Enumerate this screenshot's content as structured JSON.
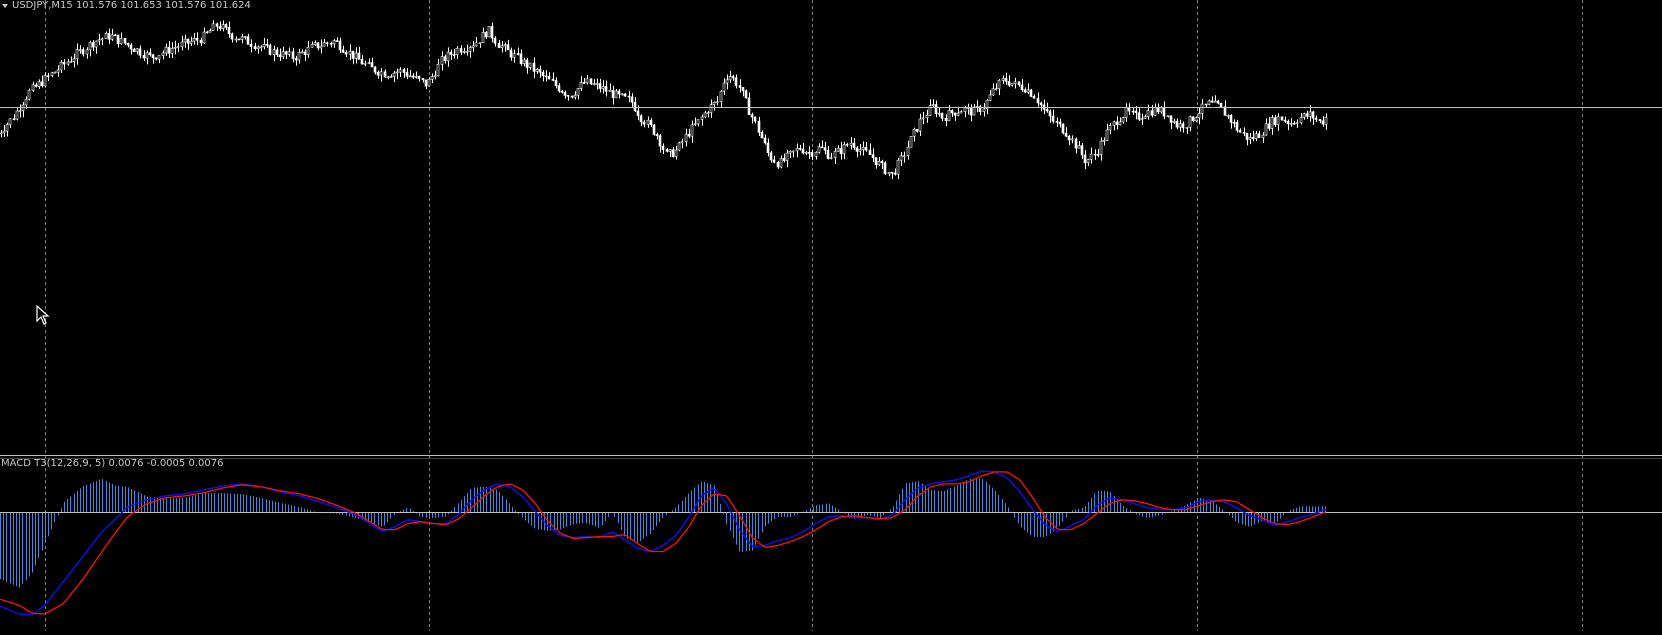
{
  "window": {
    "header_label": "USDJPY,M15  101.576 101.653 101.576 101.624",
    "indicator_label": "MACD T3(12,26,9, 5) 0.0076 -0.0005 0.0076"
  },
  "chart_data": [
    {
      "type": "candlestick",
      "title": "USDJPY,M15",
      "symbol": "USDJPY",
      "timeframe": "M15",
      "last_bar": {
        "open": 101.576,
        "high": 101.653,
        "low": 101.576,
        "close": 101.624
      },
      "ylim": [
        100.4,
        101.9
      ],
      "bid_level": 101.62,
      "grid": true,
      "colors": {
        "candle": "#ffffff",
        "background": "#000000",
        "grid": "#808080",
        "bid_line": "#c0c0c0"
      },
      "price_path": [
        [
          0,
          101.52
        ],
        [
          6,
          101.58
        ],
        [
          12,
          101.67
        ],
        [
          20,
          101.73
        ],
        [
          28,
          101.79
        ],
        [
          38,
          101.86
        ],
        [
          44,
          101.88
        ],
        [
          52,
          101.84
        ],
        [
          60,
          101.8
        ],
        [
          70,
          101.84
        ],
        [
          80,
          101.87
        ],
        [
          86,
          101.92
        ],
        [
          92,
          101.88
        ],
        [
          100,
          101.85
        ],
        [
          108,
          101.82
        ],
        [
          116,
          101.8
        ],
        [
          124,
          101.84
        ],
        [
          132,
          101.86
        ],
        [
          140,
          101.8
        ],
        [
          146,
          101.76
        ],
        [
          152,
          101.74
        ],
        [
          158,
          101.75
        ],
        [
          164,
          101.72
        ],
        [
          168,
          101.7
        ],
        [
          174,
          101.79
        ],
        [
          180,
          101.83
        ],
        [
          184,
          101.84
        ],
        [
          188,
          101.86
        ],
        [
          192,
          101.9
        ],
        [
          196,
          101.85
        ],
        [
          200,
          101.82
        ],
        [
          206,
          101.78
        ],
        [
          212,
          101.74
        ],
        [
          218,
          101.7
        ],
        [
          224,
          101.66
        ],
        [
          230,
          101.71
        ],
        [
          236,
          101.69
        ],
        [
          242,
          101.66
        ],
        [
          248,
          101.64
        ],
        [
          252,
          101.58
        ],
        [
          258,
          101.52
        ],
        [
          262,
          101.44
        ],
        [
          266,
          101.46
        ],
        [
          270,
          101.52
        ],
        [
          274,
          101.56
        ],
        [
          278,
          101.61
        ],
        [
          282,
          101.64
        ],
        [
          284,
          101.71
        ],
        [
          286,
          101.74
        ],
        [
          290,
          101.7
        ],
        [
          294,
          101.61
        ],
        [
          298,
          101.53
        ],
        [
          302,
          101.44
        ],
        [
          306,
          101.41
        ],
        [
          310,
          101.44
        ],
        [
          314,
          101.47
        ],
        [
          318,
          101.45
        ],
        [
          322,
          101.47
        ],
        [
          326,
          101.44
        ],
        [
          330,
          101.46
        ],
        [
          334,
          101.49
        ],
        [
          338,
          101.46
        ],
        [
          342,
          101.44
        ],
        [
          346,
          101.4
        ],
        [
          350,
          101.37
        ],
        [
          354,
          101.43
        ],
        [
          358,
          101.51
        ],
        [
          362,
          101.58
        ],
        [
          366,
          101.62
        ],
        [
          370,
          101.58
        ],
        [
          374,
          101.6
        ],
        [
          378,
          101.61
        ],
        [
          382,
          101.6
        ],
        [
          386,
          101.62
        ],
        [
          390,
          101.68
        ],
        [
          394,
          101.72
        ],
        [
          398,
          101.7
        ],
        [
          402,
          101.69
        ],
        [
          406,
          101.66
        ],
        [
          410,
          101.6
        ],
        [
          414,
          101.56
        ],
        [
          418,
          101.53
        ],
        [
          422,
          101.48
        ],
        [
          426,
          101.42
        ],
        [
          430,
          101.45
        ],
        [
          434,
          101.52
        ],
        [
          438,
          101.57
        ],
        [
          442,
          101.6
        ],
        [
          446,
          101.58
        ],
        [
          450,
          101.6
        ],
        [
          454,
          101.61
        ],
        [
          458,
          101.59
        ],
        [
          462,
          101.55
        ],
        [
          466,
          101.56
        ],
        [
          470,
          101.6
        ],
        [
          474,
          101.63
        ],
        [
          478,
          101.62
        ],
        [
          482,
          101.58
        ],
        [
          486,
          101.53
        ],
        [
          490,
          101.5
        ],
        [
          494,
          101.52
        ],
        [
          498,
          101.56
        ],
        [
          502,
          101.58
        ],
        [
          506,
          101.56
        ],
        [
          510,
          101.58
        ],
        [
          514,
          101.59
        ],
        [
          518,
          101.56
        ],
        [
          520,
          101.58
        ]
      ],
      "x_range": [
        0,
        520
      ]
    },
    {
      "type": "line",
      "title": "MACD T3(12,26,9, 5)",
      "values_shown": [
        0.0076,
        -0.0005,
        0.0076
      ],
      "ylim": [
        -0.12,
        0.052
      ],
      "colors": {
        "macd": "#1010ff",
        "signal": "#ff1010",
        "histogram": "#3d8be0",
        "zero_line": "#c0c0c0"
      },
      "macd_path": [
        [
          0,
          -0.095
        ],
        [
          6,
          -0.103
        ],
        [
          10,
          -0.104
        ],
        [
          14,
          -0.094
        ],
        [
          20,
          -0.07
        ],
        [
          26,
          -0.045
        ],
        [
          32,
          -0.02
        ],
        [
          36,
          -0.008
        ],
        [
          40,
          0.005
        ],
        [
          46,
          0.012
        ],
        [
          52,
          0.016
        ],
        [
          58,
          0.018
        ],
        [
          64,
          0.022
        ],
        [
          70,
          0.026
        ],
        [
          76,
          0.028
        ],
        [
          82,
          0.025
        ],
        [
          88,
          0.02
        ],
        [
          94,
          0.016
        ],
        [
          100,
          0.01
        ],
        [
          106,
          0.004
        ],
        [
          112,
          -0.004
        ],
        [
          116,
          -0.012
        ],
        [
          120,
          -0.02
        ],
        [
          124,
          -0.015
        ],
        [
          128,
          -0.008
        ],
        [
          132,
          -0.01
        ],
        [
          136,
          -0.012
        ],
        [
          140,
          -0.012
        ],
        [
          144,
          -0.002
        ],
        [
          148,
          0.012
        ],
        [
          152,
          0.022
        ],
        [
          156,
          0.028
        ],
        [
          160,
          0.025
        ],
        [
          164,
          0.015
        ],
        [
          168,
          0.0
        ],
        [
          172,
          -0.015
        ],
        [
          176,
          -0.024
        ],
        [
          180,
          -0.026
        ],
        [
          184,
          -0.025
        ],
        [
          188,
          -0.026
        ],
        [
          192,
          -0.02
        ],
        [
          196,
          -0.028
        ],
        [
          200,
          -0.037
        ],
        [
          204,
          -0.04
        ],
        [
          208,
          -0.034
        ],
        [
          212,
          -0.024
        ],
        [
          216,
          -0.006
        ],
        [
          220,
          0.016
        ],
        [
          224,
          0.024
        ],
        [
          228,
          0.008
        ],
        [
          232,
          -0.018
        ],
        [
          236,
          -0.035
        ],
        [
          240,
          -0.034
        ],
        [
          244,
          -0.029
        ],
        [
          248,
          -0.026
        ],
        [
          252,
          -0.02
        ],
        [
          256,
          -0.012
        ],
        [
          260,
          -0.005
        ],
        [
          264,
          -0.004
        ],
        [
          268,
          -0.006
        ],
        [
          272,
          -0.006
        ],
        [
          276,
          -0.008
        ],
        [
          280,
          -0.003
        ],
        [
          284,
          0.012
        ],
        [
          288,
          0.024
        ],
        [
          292,
          0.028
        ],
        [
          296,
          0.03
        ],
        [
          300,
          0.032
        ],
        [
          304,
          0.036
        ],
        [
          308,
          0.041
        ],
        [
          312,
          0.04
        ],
        [
          316,
          0.034
        ],
        [
          320,
          0.02
        ],
        [
          324,
          0.002
        ],
        [
          328,
          -0.014
        ],
        [
          332,
          -0.02
        ],
        [
          336,
          -0.014
        ],
        [
          340,
          -0.008
        ],
        [
          344,
          0.006
        ],
        [
          348,
          0.014
        ],
        [
          352,
          0.012
        ],
        [
          356,
          0.008
        ],
        [
          360,
          0.004
        ],
        [
          364,
          0.002
        ],
        [
          368,
          0.002
        ],
        [
          372,
          0.004
        ],
        [
          376,
          0.01
        ],
        [
          380,
          0.012
        ],
        [
          384,
          0.01
        ],
        [
          388,
          0.004
        ],
        [
          392,
          -0.004
        ],
        [
          396,
          -0.008
        ],
        [
          400,
          -0.014
        ],
        [
          404,
          -0.01
        ],
        [
          408,
          -0.006
        ],
        [
          412,
          -0.002
        ],
        [
          416,
          0.002
        ]
      ],
      "signal_path": [
        [
          0,
          -0.088
        ],
        [
          6,
          -0.094
        ],
        [
          10,
          -0.102
        ],
        [
          14,
          -0.103
        ],
        [
          20,
          -0.092
        ],
        [
          26,
          -0.068
        ],
        [
          32,
          -0.04
        ],
        [
          36,
          -0.022
        ],
        [
          40,
          -0.005
        ],
        [
          46,
          0.008
        ],
        [
          52,
          0.014
        ],
        [
          58,
          0.016
        ],
        [
          64,
          0.019
        ],
        [
          70,
          0.024
        ],
        [
          76,
          0.027
        ],
        [
          82,
          0.025
        ],
        [
          88,
          0.021
        ],
        [
          94,
          0.018
        ],
        [
          100,
          0.013
        ],
        [
          106,
          0.006
        ],
        [
          112,
          -0.002
        ],
        [
          116,
          -0.01
        ],
        [
          120,
          -0.018
        ],
        [
          124,
          -0.018
        ],
        [
          128,
          -0.012
        ],
        [
          132,
          -0.01
        ],
        [
          136,
          -0.012
        ],
        [
          140,
          -0.013
        ],
        [
          144,
          -0.007
        ],
        [
          148,
          0.004
        ],
        [
          152,
          0.016
        ],
        [
          156,
          0.025
        ],
        [
          160,
          0.028
        ],
        [
          164,
          0.022
        ],
        [
          168,
          0.008
        ],
        [
          172,
          -0.01
        ],
        [
          176,
          -0.022
        ],
        [
          180,
          -0.027
        ],
        [
          184,
          -0.026
        ],
        [
          188,
          -0.025
        ],
        [
          192,
          -0.025
        ],
        [
          196,
          -0.023
        ],
        [
          200,
          -0.032
        ],
        [
          204,
          -0.04
        ],
        [
          208,
          -0.04
        ],
        [
          212,
          -0.032
        ],
        [
          216,
          -0.016
        ],
        [
          220,
          0.006
        ],
        [
          224,
          0.018
        ],
        [
          228,
          0.016
        ],
        [
          232,
          -0.004
        ],
        [
          236,
          -0.026
        ],
        [
          240,
          -0.036
        ],
        [
          244,
          -0.034
        ],
        [
          248,
          -0.03
        ],
        [
          252,
          -0.025
        ],
        [
          256,
          -0.018
        ],
        [
          260,
          -0.01
        ],
        [
          264,
          -0.005
        ],
        [
          268,
          -0.004
        ],
        [
          272,
          -0.006
        ],
        [
          276,
          -0.007
        ],
        [
          280,
          -0.006
        ],
        [
          284,
          0.002
        ],
        [
          288,
          0.016
        ],
        [
          292,
          0.025
        ],
        [
          296,
          0.028
        ],
        [
          300,
          0.028
        ],
        [
          304,
          0.03
        ],
        [
          308,
          0.036
        ],
        [
          312,
          0.04
        ],
        [
          316,
          0.04
        ],
        [
          320,
          0.032
        ],
        [
          324,
          0.014
        ],
        [
          328,
          -0.006
        ],
        [
          332,
          -0.018
        ],
        [
          336,
          -0.018
        ],
        [
          340,
          -0.012
        ],
        [
          344,
          -0.002
        ],
        [
          348,
          0.008
        ],
        [
          352,
          0.012
        ],
        [
          356,
          0.011
        ],
        [
          360,
          0.008
        ],
        [
          364,
          0.004
        ],
        [
          368,
          0.002
        ],
        [
          372,
          0.002
        ],
        [
          376,
          0.006
        ],
        [
          380,
          0.01
        ],
        [
          384,
          0.012
        ],
        [
          388,
          0.01
        ],
        [
          392,
          0.002
        ],
        [
          396,
          -0.006
        ],
        [
          400,
          -0.012
        ],
        [
          404,
          -0.013
        ],
        [
          408,
          -0.01
        ],
        [
          412,
          -0.005
        ],
        [
          416,
          0.0
        ]
      ],
      "x_range": [
        0,
        416
      ]
    }
  ]
}
